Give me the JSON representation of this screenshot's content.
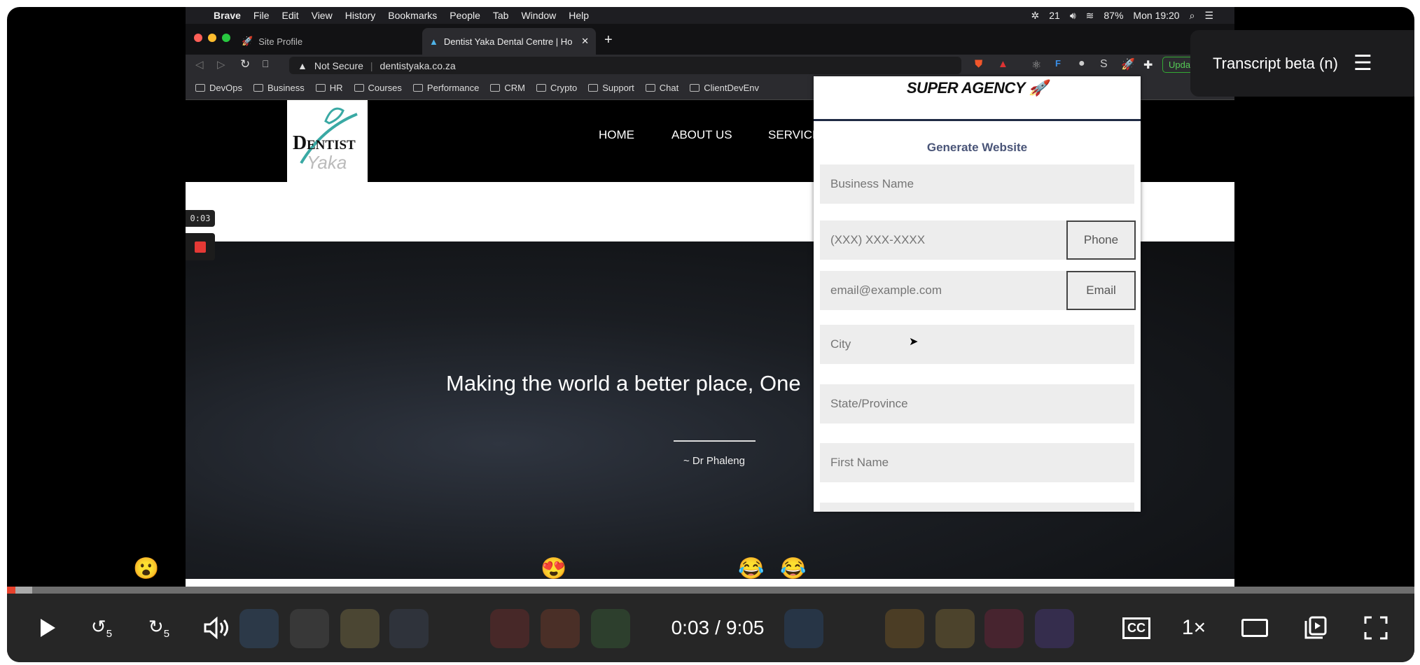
{
  "menubar": {
    "app": "Brave",
    "items": [
      "File",
      "Edit",
      "View",
      "History",
      "Bookmarks",
      "People",
      "Tab",
      "Window",
      "Help"
    ],
    "badge": "21",
    "battery": "87%",
    "clock": "Mon 19:20"
  },
  "tabs": [
    {
      "label": "Site Profile"
    },
    {
      "label": "Dentist Yaka Dental Centre | Ho"
    }
  ],
  "address": {
    "security": "Not Secure",
    "url": "dentistyaka.co.za",
    "update_label": "Update"
  },
  "bookmarks": [
    "DevOps",
    "Business",
    "HR",
    "Courses",
    "Performance",
    "CRM",
    "Crypto",
    "Support",
    "Chat",
    "ClientDevEnv"
  ],
  "site": {
    "logo": "Dentist Yaka",
    "nav": [
      "HOME",
      "ABOUT US",
      "SERVICE"
    ],
    "hero_text": "Making the world a better place, One",
    "quote": "~ Dr Phaleng",
    "scroll_top_icon": "chevron-up-icon"
  },
  "popup": {
    "brand": "SUPER AGENCY",
    "title": "Generate Website",
    "fields": {
      "business": "Business Name",
      "phone": "(XXX) XXX-XXXX",
      "email": "email@example.com",
      "city": "City",
      "state": "State/Province",
      "first_name": "First Name"
    },
    "phone_label": "Phone",
    "email_label": "Email"
  },
  "recorder": {
    "elapsed": "0:03"
  },
  "transcript": {
    "label": "Transcript beta (n)"
  },
  "reactions": [
    "😮",
    "😍",
    "😂",
    "😂"
  ],
  "player": {
    "current": "0:03",
    "duration": "9:05",
    "time_sep": "/",
    "speed": "1×",
    "cc": "CC",
    "progress_percent": 0.6,
    "accent": "#e8412c"
  }
}
